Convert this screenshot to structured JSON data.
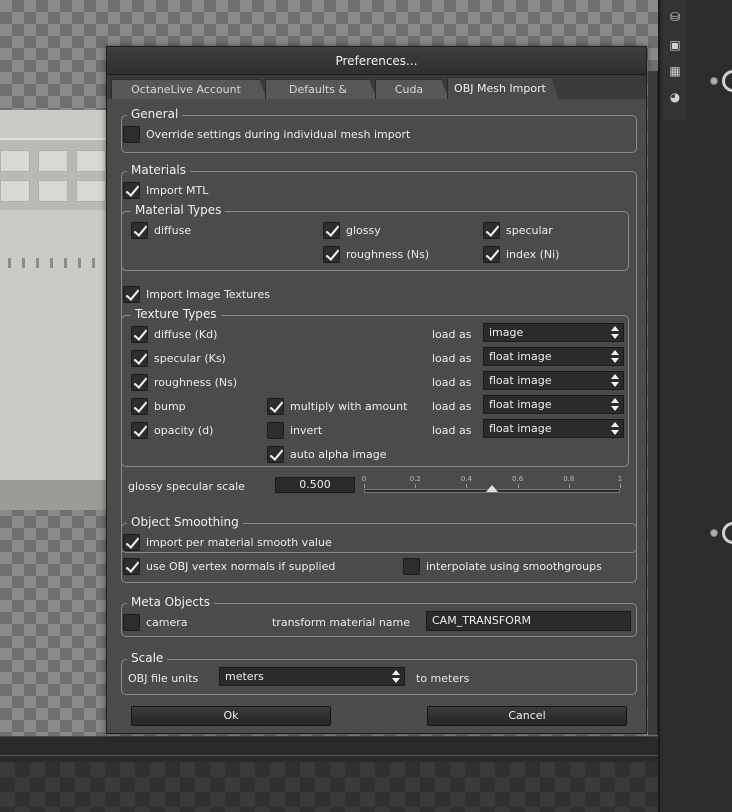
{
  "dialog": {
    "title": "Preferences...",
    "tabs": [
      {
        "label": "OctaneLive Account Settings"
      },
      {
        "label": "Defaults & Controls"
      },
      {
        "label": "Cuda Devices"
      },
      {
        "label": "OBJ Mesh Import",
        "active": true
      }
    ],
    "general": {
      "label": "General",
      "override": {
        "label": "Override settings during individual mesh import",
        "checked": false
      }
    },
    "materials": {
      "label": "Materials",
      "import_mtl": {
        "label": "Import MTL",
        "checked": true
      },
      "material_types": {
        "label": "Material Types",
        "diffuse": {
          "label": "diffuse",
          "checked": true
        },
        "glossy": {
          "label": "glossy",
          "checked": true
        },
        "specular": {
          "label": "specular",
          "checked": true
        },
        "roughness": {
          "label": "roughness (Ns)",
          "checked": true
        },
        "index": {
          "label": "index (Ni)",
          "checked": true
        }
      },
      "import_image_textures": {
        "label": "Import Image Textures",
        "checked": true
      },
      "texture_types": {
        "label": "Texture Types",
        "load_as_label": "load as",
        "rows": [
          {
            "label": "diffuse (Kd)",
            "checked": true,
            "load_as": "image"
          },
          {
            "label": "specular (Ks)",
            "checked": true,
            "load_as": "float image"
          },
          {
            "label": "roughness (Ns)",
            "checked": true,
            "load_as": "float image"
          },
          {
            "label": "bump",
            "checked": true,
            "load_as": "float image"
          },
          {
            "label": "opacity (d)",
            "checked": true,
            "load_as": "float image"
          }
        ],
        "multiply_with_amount": {
          "label": "multiply with amount",
          "checked": true
        },
        "invert": {
          "label": "invert",
          "checked": false
        },
        "auto_alpha_image": {
          "label": "auto alpha image",
          "checked": true
        }
      },
      "glossy_specular_scale": {
        "label": "glossy specular scale",
        "value": "0.500",
        "slider_value": 0.5,
        "ticks": [
          "0",
          "0.2",
          "0.4",
          "0.6",
          "0.8",
          "1"
        ]
      }
    },
    "object_smoothing": {
      "label": "Object Smoothing",
      "per_material": {
        "label": "import per material smooth value",
        "checked": true
      },
      "vertex_normals": {
        "label": "use OBJ vertex normals if supplied",
        "checked": true
      },
      "smoothgroups": {
        "label": "interpolate using smoothgroups",
        "checked": false
      }
    },
    "meta_objects": {
      "label": "Meta Objects",
      "camera": {
        "label": "camera",
        "checked": false
      },
      "transform_label": "transform material name",
      "transform_value": "CAM_TRANSFORM"
    },
    "scale": {
      "label": "Scale",
      "units_label": "OBJ file units",
      "units_value": "meters",
      "to_label": "to meters"
    },
    "ok_label": "Ok",
    "cancel_label": "Cancel"
  },
  "side_icons": [
    "database-icon",
    "image-icon",
    "texture-icon",
    "material-icon"
  ]
}
